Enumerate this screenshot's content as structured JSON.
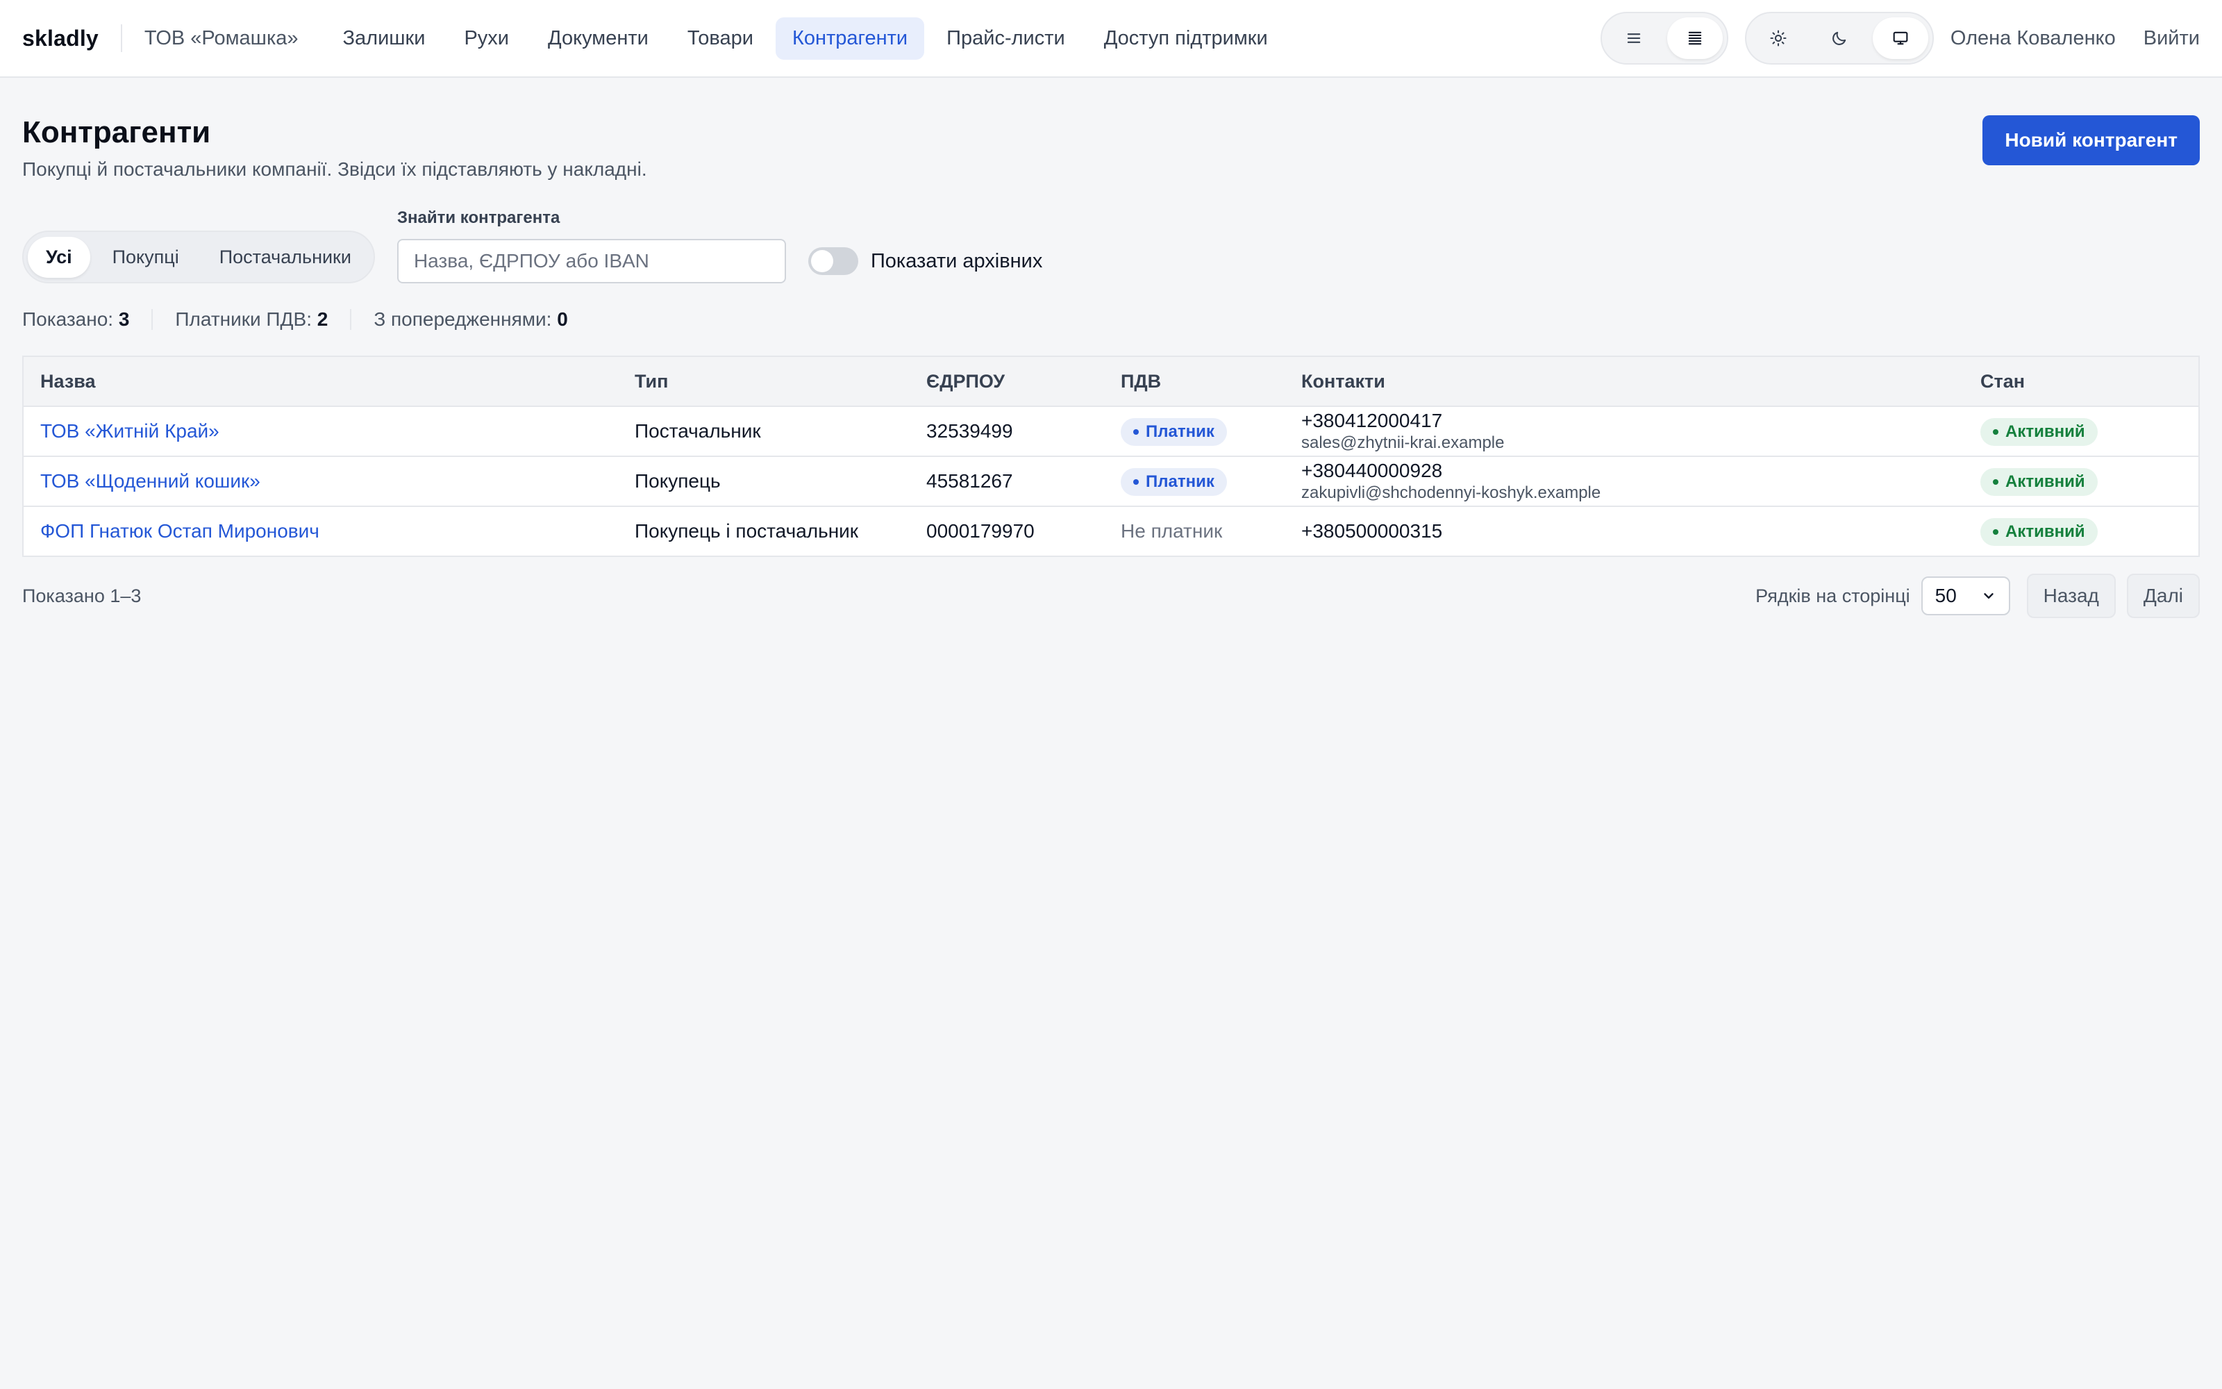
{
  "header": {
    "brand": "skladly",
    "company": "ТОВ «Ромашка»",
    "nav": [
      {
        "label": "Залишки",
        "active": false
      },
      {
        "label": "Рухи",
        "active": false
      },
      {
        "label": "Документи",
        "active": false
      },
      {
        "label": "Товари",
        "active": false
      },
      {
        "label": "Контрагенти",
        "active": true
      },
      {
        "label": "Прайс-листи",
        "active": false
      },
      {
        "label": "Доступ підтримки",
        "active": false
      }
    ],
    "density_icons": [
      "list-comfortable-icon",
      "list-compact-icon"
    ],
    "theme_icons": [
      "sun-icon",
      "moon-icon",
      "monitor-icon"
    ],
    "user": "Олена Коваленко",
    "logout": "Вийти"
  },
  "page": {
    "title": "Контрагенти",
    "subtitle": "Покупці й постачальники компанії. Звідси їх підставляють у накладні.",
    "new_button": "Новий контрагент"
  },
  "filters": {
    "tabs": [
      {
        "label": "Усі",
        "active": true
      },
      {
        "label": "Покупці",
        "active": false
      },
      {
        "label": "Постачальники",
        "active": false
      }
    ],
    "search_label": "Знайти контрагента",
    "search_placeholder": "Назва, ЄДРПОУ або IBAN",
    "search_value": "",
    "archive_toggle_label": "Показати архівних",
    "archive_toggle_on": false
  },
  "stats": {
    "shown_label": "Показано:",
    "shown_value": "3",
    "vat_label": "Платники ПДВ:",
    "vat_value": "2",
    "warn_label": "З попередженнями:",
    "warn_value": "0"
  },
  "table": {
    "columns": [
      "Назва",
      "Тип",
      "ЄДРПОУ",
      "ПДВ",
      "Контакти",
      "Стан"
    ],
    "rows": [
      {
        "name": "ТОВ «Житній Край»",
        "type": "Постачальник",
        "code": "32539499",
        "vat": "Платник",
        "vat_payer": true,
        "phone": "+380412000417",
        "email": "sales@zhytnii-krai.example",
        "state": "Активний"
      },
      {
        "name": "ТОВ «Щоденний кошик»",
        "type": "Покупець",
        "code": "45581267",
        "vat": "Платник",
        "vat_payer": true,
        "phone": "+380440000928",
        "email": "zakupivli@shchodennyi-koshyk.example",
        "state": "Активний"
      },
      {
        "name": "ФОП Гнатюк Остап Миронович",
        "type": "Покупець і постачальник",
        "code": "0000179970",
        "vat": "Не платник",
        "vat_payer": false,
        "phone": "+380500000315",
        "email": "",
        "state": "Активний"
      }
    ]
  },
  "footer": {
    "shown": "Показано 1–3",
    "rows_per_page_label": "Рядків на сторінці",
    "rows_per_page_value": "50",
    "prev": "Назад",
    "next": "Далі"
  },
  "colors": {
    "accent": "#2457d6",
    "active_green": "#15803d",
    "background": "#f5f6f8"
  }
}
